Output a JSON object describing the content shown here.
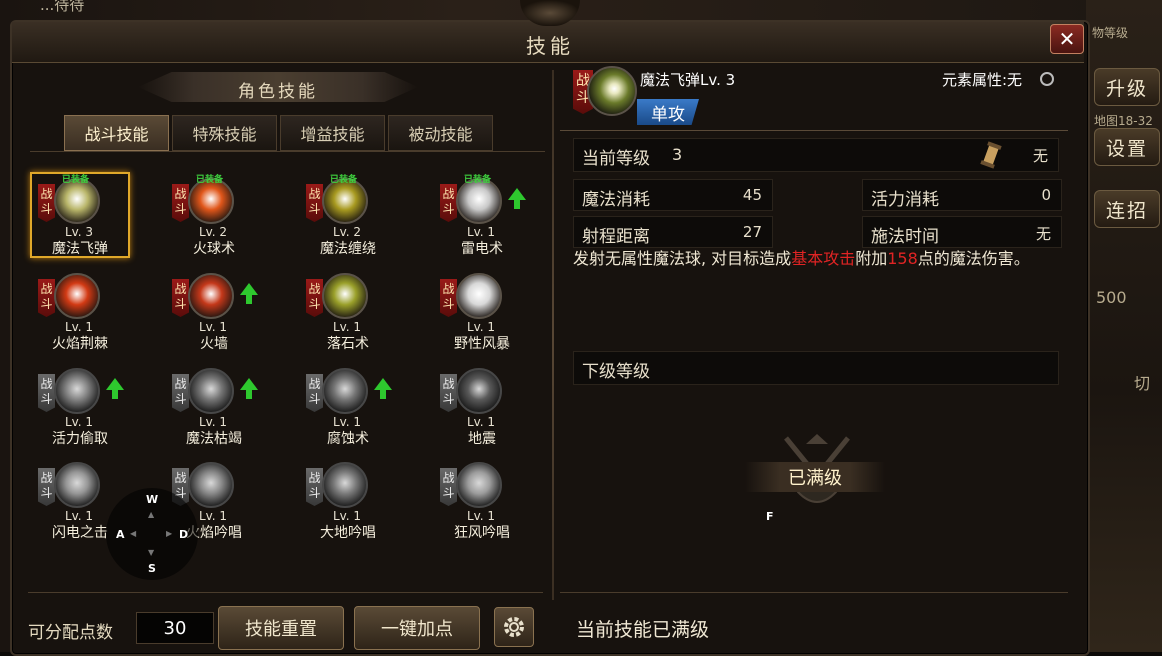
{
  "background": {
    "top_text": "...待待"
  },
  "side": {
    "upgrade": "升级",
    "settings": "设置",
    "combo": "连招",
    "map_text": "地图18-32",
    "rank_text": "物等级",
    "count_text": "500",
    "switch_text": "切"
  },
  "window": {
    "title": "技能",
    "close_icon": "close-icon"
  },
  "left": {
    "section_title": "角色技能",
    "tabs": [
      {
        "label": "战斗技能",
        "active": true
      },
      {
        "label": "特殊技能",
        "active": false
      },
      {
        "label": "增益技能",
        "active": false
      },
      {
        "label": "被动技能",
        "active": false
      }
    ],
    "badge_text": "战斗",
    "equipped_text": "已装备",
    "skills": [
      {
        "name": "魔法飞弹",
        "level": "Lv. 3",
        "equipped": true,
        "upgradable": false,
        "unlocked": true,
        "selected": true,
        "color": "#b9b66a"
      },
      {
        "name": "火球术",
        "level": "Lv. 2",
        "equipped": true,
        "upgradable": false,
        "unlocked": true,
        "selected": false,
        "color": "#e0561a"
      },
      {
        "name": "魔法缠绕",
        "level": "Lv. 2",
        "equipped": true,
        "upgradable": false,
        "unlocked": true,
        "selected": false,
        "color": "#a89a20"
      },
      {
        "name": "雷电术",
        "level": "Lv. 1",
        "equipped": true,
        "upgradable": true,
        "unlocked": true,
        "selected": false,
        "color": "#c8c8c8"
      },
      {
        "name": "火焰荆棘",
        "level": "Lv. 1",
        "equipped": false,
        "upgradable": false,
        "unlocked": true,
        "selected": false,
        "color": "#d23a14"
      },
      {
        "name": "火墙",
        "level": "Lv. 1",
        "equipped": false,
        "upgradable": true,
        "unlocked": true,
        "selected": false,
        "color": "#c4381a"
      },
      {
        "name": "落石术",
        "level": "Lv. 1",
        "equipped": false,
        "upgradable": false,
        "unlocked": true,
        "selected": false,
        "color": "#9aa02a"
      },
      {
        "name": "野性风暴",
        "level": "Lv. 1",
        "equipped": false,
        "upgradable": false,
        "unlocked": true,
        "selected": false,
        "color": "#d8d8d8"
      },
      {
        "name": "活力偷取",
        "level": "Lv. 1",
        "equipped": false,
        "upgradable": true,
        "unlocked": false,
        "selected": false,
        "color": "#9a9a9a"
      },
      {
        "name": "魔法枯竭",
        "level": "Lv. 1",
        "equipped": false,
        "upgradable": true,
        "unlocked": false,
        "selected": false,
        "color": "#8a8a8a"
      },
      {
        "name": "腐蚀术",
        "level": "Lv. 1",
        "equipped": false,
        "upgradable": true,
        "unlocked": false,
        "selected": false,
        "color": "#8a8a8a"
      },
      {
        "name": "地震",
        "level": "Lv. 1",
        "equipped": false,
        "upgradable": false,
        "unlocked": false,
        "selected": false,
        "color": "#6a6a6a"
      },
      {
        "name": "闪电之击",
        "level": "Lv. 1",
        "equipped": false,
        "upgradable": false,
        "unlocked": false,
        "selected": false,
        "color": "#b0b0b0"
      },
      {
        "name": "火焰吟唱",
        "level": "Lv. 1",
        "equipped": false,
        "upgradable": false,
        "unlocked": false,
        "selected": false,
        "color": "#a0a0a0"
      },
      {
        "name": "大地吟唱",
        "level": "Lv. 1",
        "equipped": false,
        "upgradable": false,
        "unlocked": false,
        "selected": false,
        "color": "#909090"
      },
      {
        "name": "狂风吟唱",
        "level": "Lv. 1",
        "equipped": false,
        "upgradable": false,
        "unlocked": false,
        "selected": false,
        "color": "#b8b8b8"
      }
    ],
    "points_label": "可分配点数",
    "points_value": "30",
    "reset_button": "技能重置",
    "auto_button": "一键加点",
    "settings_icon": "gear-icon"
  },
  "joystick": {
    "w": "W",
    "a": "A",
    "s": "S",
    "d": "D"
  },
  "detail": {
    "badge": "战斗",
    "name": "魔法飞弹Lv. 3",
    "element_label": "元素属性:无",
    "target_type": "单攻",
    "current_level_label": "当前等级",
    "current_level_value": "3",
    "item_value": "无",
    "mana_cost_label": "魔法消耗",
    "mana_cost_value": "45",
    "vigor_cost_label": "活力消耗",
    "vigor_cost_value": "0",
    "range_label": "射程距离",
    "range_value": "27",
    "cast_time_label": "施法时间",
    "cast_time_value": "无",
    "desc_part1": "发射无属性魔法球, 对目标造成",
    "desc_highlight1": "基本攻击",
    "desc_part2": "附加",
    "desc_highlight2": "158",
    "desc_part3": "点的魔法伤害。",
    "next_level_label": "下级等级",
    "maxed_label": "已满级",
    "f_key": "F",
    "bottom_status": "当前技能已满级"
  }
}
